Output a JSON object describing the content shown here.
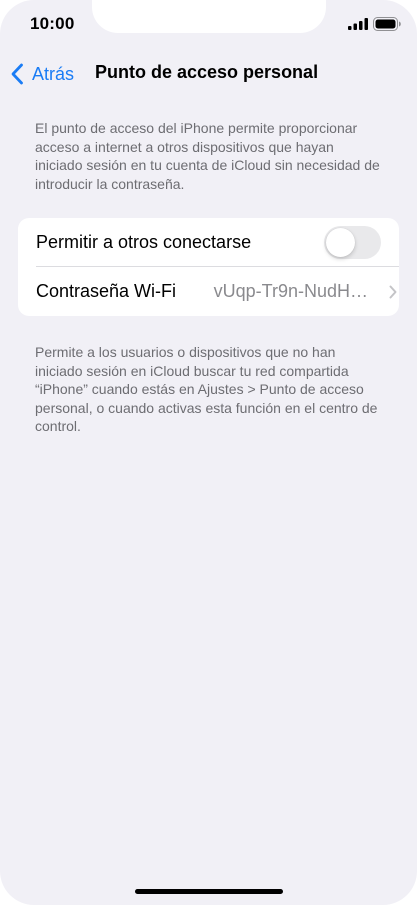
{
  "status_bar": {
    "time": "10:00",
    "signal_icon": "cellular-signal-icon",
    "battery_icon": "battery-full-icon"
  },
  "nav": {
    "back_label": "Atrás",
    "back_icon": "chevron-left-icon",
    "title": "Punto de acceso personal"
  },
  "header_note": "El punto de acceso del iPhone permite proporcionar acceso a internet a otros dispositivos que hayan iniciado sesión en tu cuenta de iCloud sin necesidad de introducir la contraseña.",
  "settings": {
    "allow_others": {
      "label": "Permitir a otros conectarse",
      "enabled": false
    },
    "wifi_password": {
      "label": "Contraseña Wi-Fi",
      "value": "vUqp-Tr9n-NudH…",
      "chevron_icon": "chevron-right-icon"
    }
  },
  "footer_note": "Permite a los usuarios o dispositivos que no han iniciado sesión en iCloud buscar tu red compartida “iPhone” cuando estás en Ajustes > Punto de acceso personal, o cuando activas esta función en el centro de control.",
  "colors": {
    "accent": "#1a7cf5",
    "background": "#f1f0f6",
    "secondary_text": "#6d6d72",
    "toggle_off": "#e9e9eb"
  }
}
